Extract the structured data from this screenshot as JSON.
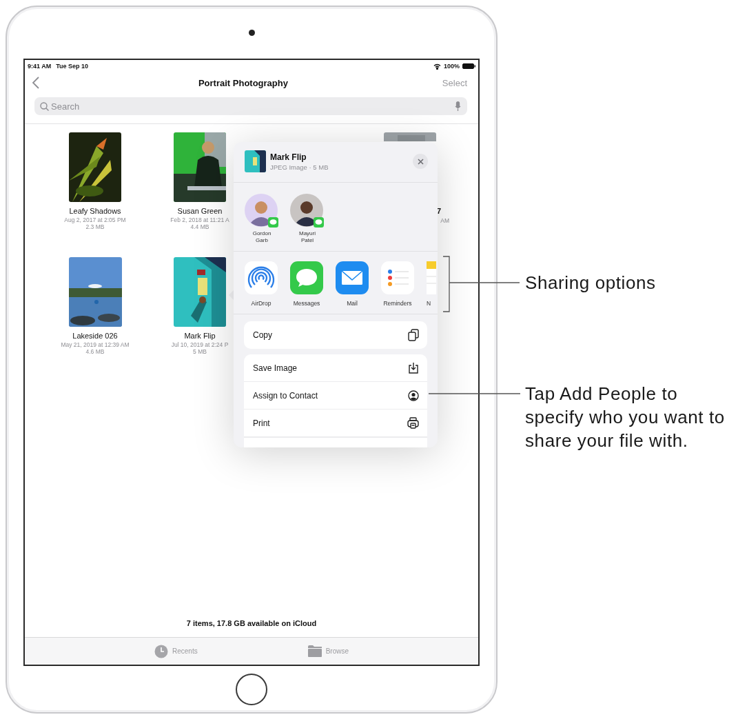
{
  "status_bar": {
    "time": "9:41 AM",
    "date": "Tue Sep 10",
    "battery": "100%"
  },
  "nav_bar": {
    "title": "Portrait Photography",
    "action": "Select"
  },
  "search": {
    "placeholder": "Search"
  },
  "files": [
    {
      "kind": "file",
      "name": "Leafy Shadows",
      "date": "Aug 2, 2017 at 2:05 PM",
      "size": "2.3 MB"
    },
    {
      "kind": "file",
      "name": "Susan Green",
      "date": "Feb 2, 2018 at 11:21 A",
      "size": "4.4 MB"
    },
    {
      "kind": "partial",
      "name": "7",
      "date": "AM"
    },
    {
      "kind": "file",
      "name": "Lakeside 026",
      "date": "May 21, 2019 at 12:39 AM",
      "size": "4.6 MB"
    },
    {
      "kind": "file",
      "name": "Mark Flip",
      "date": "Jul 10, 2019 at 2:24 P",
      "size": "5 MB"
    }
  ],
  "share_sheet": {
    "file": {
      "name": "Mark Flip",
      "info": "JPEG Image · 5 MB"
    },
    "people": [
      {
        "name": "Gordon Garb",
        "kind": "memoji"
      },
      {
        "name": "Mayuri Patel"
      }
    ],
    "apps": [
      {
        "kind": "airdrop",
        "label": "AirDrop"
      },
      {
        "kind": "messages",
        "label": "Messages"
      },
      {
        "kind": "mail",
        "label": "Mail"
      },
      {
        "kind": "reminders",
        "label": "Reminders"
      },
      {
        "kind": "notes",
        "label": "N"
      }
    ],
    "action_groups": [
      [
        {
          "kind": "copy",
          "label": "Copy"
        }
      ],
      [
        {
          "kind": "save",
          "label": "Save Image"
        },
        {
          "kind": "contact",
          "label": "Assign to Contact"
        },
        {
          "kind": "print",
          "label": "Print"
        }
      ]
    ]
  },
  "footer": "7 items, 17.8 GB available on iCloud",
  "tabs": [
    {
      "kind": "recents",
      "label": "Recents"
    },
    {
      "kind": "browse",
      "label": "Browse"
    }
  ],
  "callouts": [
    {
      "kind": "bracket",
      "text": "Sharing options"
    },
    {
      "kind": "line",
      "text": "Tap Add People to specify who you want to share your file with."
    }
  ]
}
